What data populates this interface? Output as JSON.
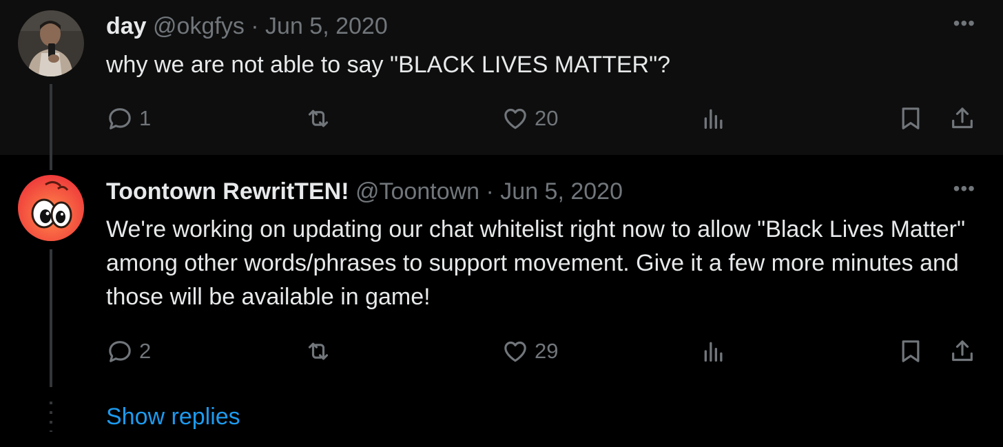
{
  "tweets": [
    {
      "name": "day",
      "handle": "@okgfys",
      "date": "Jun 5, 2020",
      "text": "why we are not able to say \"BLACK LIVES MATTER\"?",
      "replies": "1",
      "retweets": "",
      "likes": "20",
      "views": ""
    },
    {
      "name": "Toontown RewritTEN!",
      "handle": "@Toontown",
      "date": "Jun 5, 2020",
      "text": "We're working on updating our chat whitelist right now to allow \"Black Lives Matter\" among other words/phrases to support movement. Give it a few more minutes and those will be available in game!",
      "replies": "2",
      "retweets": "",
      "likes": "29",
      "views": ""
    }
  ],
  "separator": " · ",
  "more_glyph": "•••",
  "show_replies": "Show replies",
  "icons": [
    "reply-icon",
    "retweet-icon",
    "like-icon",
    "views-icon",
    "bookmark-icon",
    "share-icon",
    "more-icon"
  ],
  "colors": {
    "background": "#000000",
    "text": "#e7e9ea",
    "muted": "#71767b",
    "link": "#1d9bf0"
  }
}
